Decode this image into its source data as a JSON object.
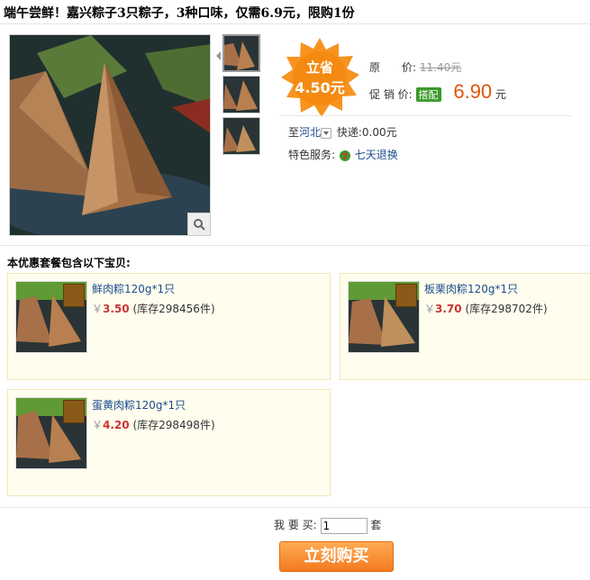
{
  "title": "端午尝鲜！嘉兴粽子3只粽子，3种口味，仅需6.9元，限购1份",
  "burst": {
    "line1": "立省",
    "line2": "4.50元",
    "color": "#f7931e"
  },
  "price_info": {
    "original_label": "原　　价:",
    "original_value": "11.40元",
    "promo_label": "促 销 价:",
    "promo_tag": "搭配",
    "promo_value": "6.90",
    "promo_unit": "元"
  },
  "shipping": {
    "dest_prefix": "至",
    "dest": "河北",
    "method": "快递:0.00元"
  },
  "service": {
    "label": "特色服务:",
    "value": "七天退换"
  },
  "section_title": "本优惠套餐包含以下宝贝:",
  "items": [
    {
      "name": "鲜肉粽120g*1只",
      "currency": "￥",
      "price": "3.50",
      "stock": "(库存298456件)"
    },
    {
      "name": "板栗肉粽120g*1只",
      "currency": "￥",
      "price": "3.70",
      "stock": "(库存298702件)"
    },
    {
      "name": "蛋黄肉粽120g*1只",
      "currency": "￥",
      "price": "4.20",
      "stock": "(库存298498件)"
    }
  ],
  "quantity": {
    "label": "我 要 买:",
    "value": "1",
    "unit": "套"
  },
  "buy_button": "立刻购买",
  "colors": {
    "accent": "#e2540a",
    "link": "#1a4d8f",
    "tag": "#3a9a2a"
  }
}
